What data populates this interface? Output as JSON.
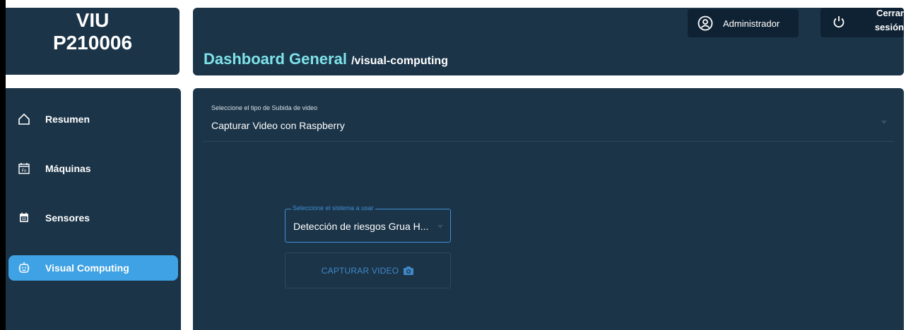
{
  "brand": {
    "title": "VIU",
    "code": "P210006"
  },
  "sidebar": {
    "items": [
      {
        "label": "Resumen",
        "icon": "home-icon",
        "active": false
      },
      {
        "label": "Máquinas",
        "icon": "calendar-fri-icon",
        "active": false
      },
      {
        "label": "Sensores",
        "icon": "calendar-grid-icon",
        "active": false
      },
      {
        "label": "Visual Computing",
        "icon": "robot-icon",
        "active": true
      }
    ]
  },
  "header": {
    "title": "Dashboard General",
    "path": "/visual-computing",
    "user_label": "Administrador",
    "logout_label_line1": "Cerrar",
    "logout_label_line2": "sesión"
  },
  "main": {
    "upload_select": {
      "label": "Seleccione el tipo de Subida de video",
      "value": "Capturar Video con Raspberry"
    },
    "system_select": {
      "label": "Seleccione el sistema a usar",
      "value": "Detección de riesgos Grua H..."
    },
    "capture_button": {
      "label": "CAPTURAR VIDEO"
    }
  },
  "colors": {
    "panel": "#1b3448",
    "accent": "#3fa2e4",
    "title": "#7fe3ea",
    "dark_button": "#0f2233"
  }
}
